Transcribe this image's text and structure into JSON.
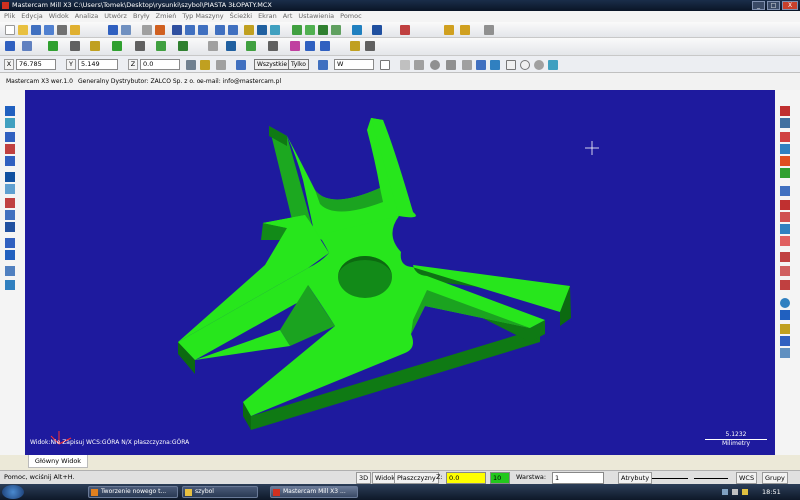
{
  "window": {
    "title": "Mastercam Mill X3  C:\\Users\\Tomek\\Desktop\\rysunki\\szybol\\PIASTA 3ŁOPATY.MCX",
    "btn_min": "_",
    "btn_max": "□",
    "btn_close": "X"
  },
  "menu": [
    "Plik",
    "Edycja",
    "Widok",
    "Analiza",
    "Utwórz",
    "Bryły",
    "Zmień",
    "Typ Maszyny",
    "Ścieżki",
    "Ekran",
    "Art",
    "Ustawienia",
    "Pomoc"
  ],
  "coords": {
    "x_label": "X",
    "x_value": "76.785",
    "y_label": "Y",
    "y_value": "5.149",
    "z_label": "Z",
    "z_value": "0.0",
    "all_button": "Wszystkie",
    "only_button": "Tylko",
    "filter_value": "W"
  },
  "info": {
    "version": "Mastercam X3 wer.1.0",
    "distributor": "Generalny Dystrybutor:  ZALCO Sp. z o. o.",
    "email": "e-mail:  info@mastercam.pl"
  },
  "viewport": {
    "view_label": "Widok:Nie Zapisuj   WCS:GÓRA   N/X płaszczyzna:GÓRA",
    "scale_value": "5.1232",
    "scale_unit": "Milimetry",
    "part_color": "#27e61c",
    "bg_color": "#1e1a9e"
  },
  "view_tab": "Główny Widok",
  "status": {
    "hint": "Pomoc, wciśnij Alt+H.",
    "btn_3d": "3D",
    "btn_widok": "Widok",
    "btn_plane": "Płaszczyzny",
    "z_label": "Z:",
    "z_value": "0.0",
    "color_value": "10",
    "level_label": "Warstwa:",
    "level_value": "1",
    "attrib": "Atrybuty",
    "wcs": "WCS",
    "groups": "Grupy"
  },
  "taskbar": {
    "items": [
      "Tworzenie nowego t...",
      "szybol",
      "Mastercam Mill X3 ..."
    ],
    "clock": "18:51"
  },
  "icons": {
    "app": "mastercam-icon",
    "folder": "folder-icon",
    "window": "window-icon"
  }
}
